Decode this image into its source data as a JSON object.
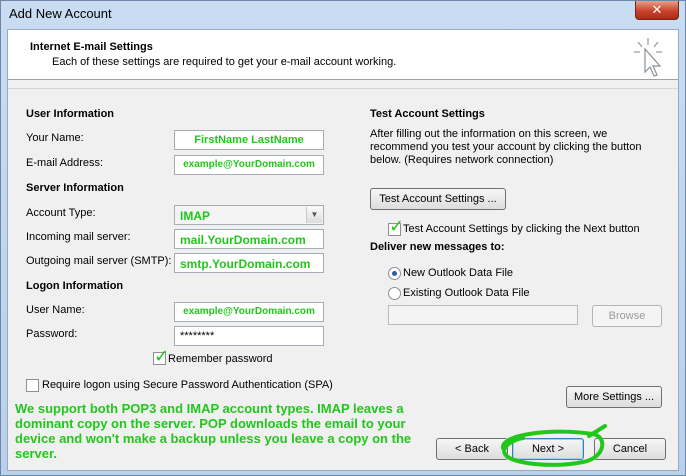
{
  "window": {
    "title": "Add New Account",
    "close_label": "✕"
  },
  "header": {
    "title": "Internet E-mail Settings",
    "subtitle": "Each of these settings are required to get your e-mail account working."
  },
  "user_info": {
    "heading": "User Information",
    "your_name_label": "Your Name:",
    "your_name_value": "FirstName LastName",
    "email_label": "E-mail Address:",
    "email_value": "example@YourDomain.com"
  },
  "server_info": {
    "heading": "Server Information",
    "account_type_label": "Account Type:",
    "account_type_value": "IMAP",
    "incoming_label": "Incoming mail server:",
    "incoming_value": "mail.YourDomain.com",
    "outgoing_label": "Outgoing mail server (SMTP):",
    "outgoing_value": "smtp.YourDomain.com"
  },
  "logon_info": {
    "heading": "Logon Information",
    "username_label": "User Name:",
    "username_value": "example@YourDomain.com",
    "password_label": "Password:",
    "password_value": "********",
    "remember_label": "Remember password",
    "spa_label": "Require logon using Secure Password Authentication (SPA)"
  },
  "test_settings": {
    "heading": "Test Account Settings",
    "description": "After filling out the information on this screen, we recommend you test your account by clicking the button below. (Requires network connection)",
    "test_button": "Test Account Settings ...",
    "test_next_label": "Test Account Settings by clicking the Next button"
  },
  "deliver": {
    "heading": "Deliver new messages to:",
    "new_file_label": "New Outlook Data File",
    "existing_file_label": "Existing Outlook Data File",
    "browse_button": "Browse"
  },
  "buttons": {
    "more_settings": "More Settings ...",
    "back": "< Back",
    "next": "Next >",
    "cancel": "Cancel"
  },
  "annotation": {
    "text": "We support both POP3 and IMAP account types. IMAP leaves a dominant copy on the server. POP downloads the email to your device and won't make a backup unless you leave a copy on the server."
  },
  "colors": {
    "annotation_green": "#22c71b",
    "title_bar": "#c9dcf2"
  }
}
